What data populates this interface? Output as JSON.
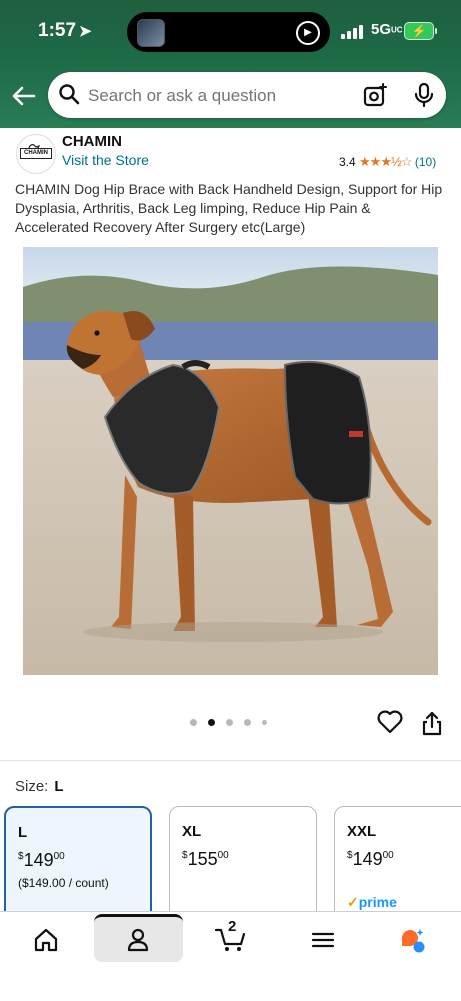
{
  "status_bar": {
    "time": "1:57",
    "network": "5G",
    "network_suffix": "UC",
    "battery_icon": "battery-charging-icon"
  },
  "search": {
    "placeholder": "Search or ask a question"
  },
  "brand": {
    "name": "CHAMIN",
    "logo_text": "CHAMIN",
    "visit_link": "Visit the Store",
    "rating": "3.4",
    "stars_visual": "★★★½☆",
    "rating_value": 3.4,
    "review_count": "(10)"
  },
  "product": {
    "title": "CHAMIN Dog Hip Brace with Back Handheld Design, Support for Hip Dysplasia, Arthritis, Back Leg limping, Reduce Hip Pain & Accelerated Recovery After Surgery etc(Large)",
    "image_alt": "Dog wearing hip brace on beach",
    "image_count": 5,
    "active_image_index": 1
  },
  "sizes": {
    "label": "Size:",
    "selected": "L",
    "options": [
      {
        "name": "L",
        "price_whole": "149",
        "price_frac": "00",
        "unit_price": "($149.00 / count)",
        "prime": ""
      },
      {
        "name": "XL",
        "price_whole": "155",
        "price_frac": "00",
        "unit_price": "",
        "prime": ""
      },
      {
        "name": "XXL",
        "price_whole": "149",
        "price_frac": "00",
        "unit_price": "",
        "prime": "prime"
      }
    ]
  },
  "currency_symbol": "$",
  "bottom_nav": {
    "cart_count": "2",
    "items": [
      "home-icon",
      "account-icon",
      "cart-icon",
      "menu-icon",
      "rufus-assistant-icon"
    ]
  },
  "colors": {
    "header_green": "#1d6a47",
    "link_teal": "#007185",
    "star_orange": "#de7921",
    "selected_border": "#2162a1",
    "prime_blue": "#1399ff"
  }
}
